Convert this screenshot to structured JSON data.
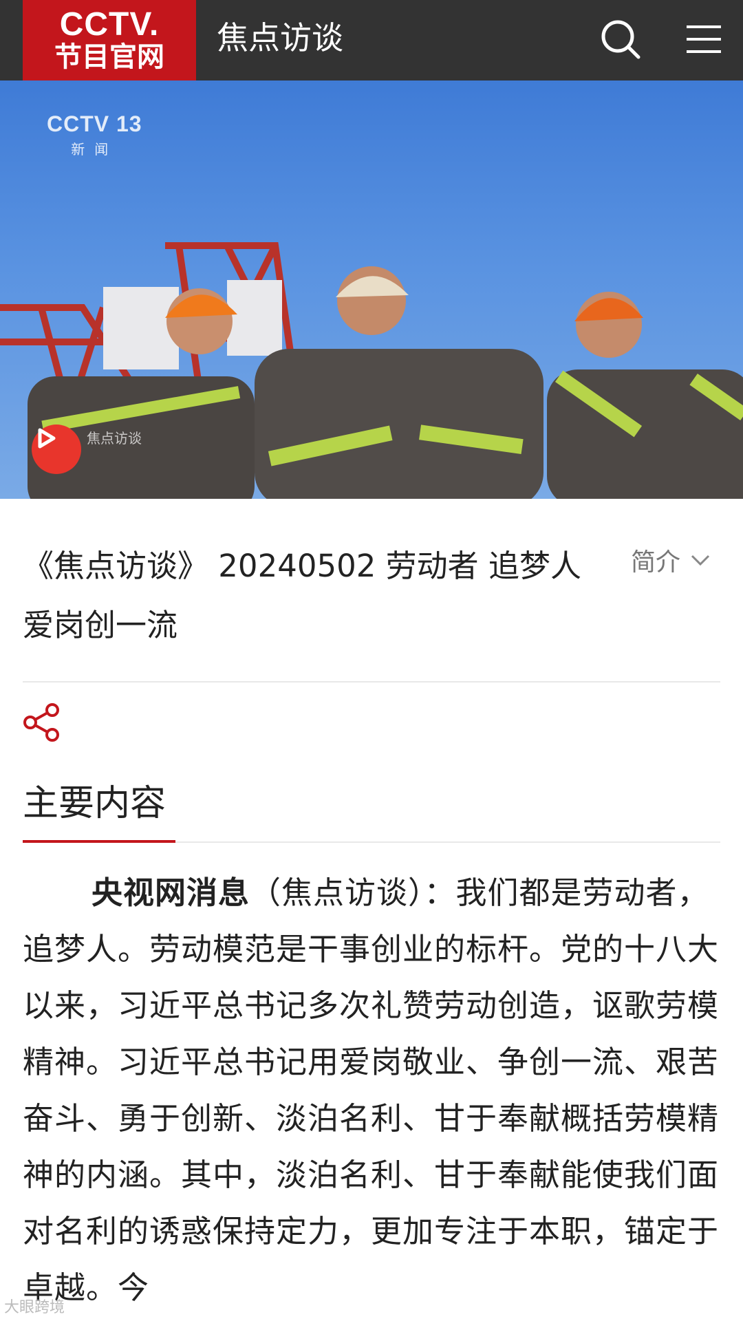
{
  "header": {
    "logo_top": "CCTV.",
    "logo_bottom": "节目官网",
    "title": "焦点访谈",
    "icons": [
      "search-icon",
      "menu-icon"
    ],
    "brand_color": "#c3161c"
  },
  "hero": {
    "channel_logo_main": "CCTV 13",
    "channel_logo_sub": "新闻",
    "watermark": "焦点访谈"
  },
  "video": {
    "title": "《焦点访谈》 20240502 劳动者 追梦人 爱岗创一流",
    "intro_label": "简介"
  },
  "section": {
    "title": "主要内容"
  },
  "article": {
    "lead": "央视网消息",
    "body": "（焦点访谈）：我们都是劳动者，追梦人。劳动模范是干事创业的标杆。党的十八大以来，习近平总书记多次礼赞劳动创造，讴歌劳模精神。习近平总书记用爱岗敬业、争创一流、艰苦奋斗、勇于创新、淡泊名利、甘于奉献概括劳模精神的内涵。其中，淡泊名利、甘于奉献能使我们面对名利的诱惑保持定力，更加专注于本职，锚定于卓越。今"
  },
  "footer": {
    "watermark": "大眼跨境"
  }
}
